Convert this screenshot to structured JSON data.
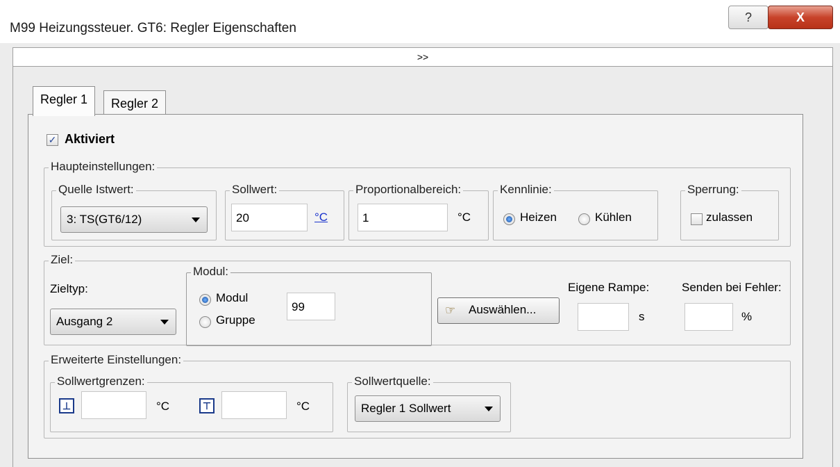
{
  "window": {
    "title": "M99 Heizungssteuer. GT6: Regler Eigenschaften",
    "help_glyph": "?",
    "close_glyph": "X",
    "expander_label": ">>"
  },
  "tabs": [
    {
      "label": "Regler 1",
      "active": true
    },
    {
      "label": "Regler 2",
      "active": false
    }
  ],
  "activated": {
    "label": "Aktiviert",
    "checked": true
  },
  "main_settings": {
    "title": "Haupteinstellungen:",
    "source": {
      "title": "Quelle Istwert:",
      "value": "3: TS(GT6/12)"
    },
    "setpoint": {
      "title": "Sollwert:",
      "value": "20",
      "unit": "°C"
    },
    "proportional": {
      "title": "Proportionalbereich:",
      "value": "1",
      "unit": "°C"
    },
    "curve": {
      "title": "Kennlinie:",
      "options": [
        "Heizen",
        "Kühlen"
      ],
      "selected": "Heizen"
    },
    "lock": {
      "title": "Sperrung:",
      "label": "zulassen",
      "checked": false
    }
  },
  "target": {
    "title": "Ziel:",
    "type_label": "Zieltyp:",
    "type_value": "Ausgang 2",
    "module": {
      "title": "Modul:",
      "options": [
        "Modul",
        "Gruppe"
      ],
      "selected": "Modul",
      "value": "99"
    },
    "select_button": "Auswählen...",
    "ramp": {
      "label": "Eigene Rampe:",
      "value": "",
      "unit": "s"
    },
    "on_error": {
      "label": "Senden bei Fehler:",
      "value": "",
      "unit": "%"
    }
  },
  "advanced": {
    "title": "Erweiterte Einstellungen:",
    "limits": {
      "title": "Sollwertgrenzen:",
      "min_value": "",
      "max_value": "",
      "unit": "°C"
    },
    "source": {
      "title": "Sollwertquelle:",
      "value": "Regler 1 Sollwert"
    }
  },
  "colors": {
    "link_unit": "#1a33cc",
    "accent_radio": "#1a4f9c"
  }
}
